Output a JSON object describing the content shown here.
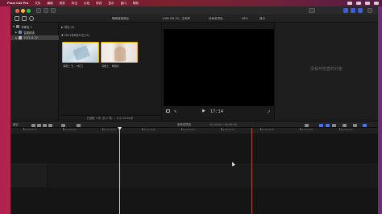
{
  "menubar": {
    "app_name": "Final Cut Pro",
    "items": [
      "文件",
      "编辑",
      "修剪",
      "标记",
      "片段",
      "修改",
      "显示",
      "窗口",
      "帮助"
    ]
  },
  "toolbar": {
    "library_label": "隔离被掐换台",
    "format_label": "1080 HD 25，立体声",
    "project_label": "未命名项目",
    "zoom_label": "48%",
    "view_label": "显示"
  },
  "sidebar": {
    "library_name": "未命名 1",
    "items": [
      {
        "label": "智能精选"
      },
      {
        "label": "2021-8-22"
      }
    ]
  },
  "browser": {
    "event_header": "项目",
    "event_count": "(0)",
    "date_header": "2021年8月22日",
    "date_count": "(2)",
    "clips": [
      {
        "label": "海报上 五 ，5红口"
      },
      {
        "label": "海报上 ，精选片"
      }
    ],
    "footer": "已选取 1 项（共 2 项），4 小 43.44 秒"
  },
  "viewer": {
    "timecode": "17:14"
  },
  "inspector": {
    "empty_text": "没有可检查的对象"
  },
  "timeline_bar": {
    "index_label": "索引",
    "project_name": "未命名项目",
    "duration_label": "00:00:00 / 00:00:00"
  },
  "ruler": {
    "ticks": [
      "00:00:00:00",
      "00:00:05:00",
      "00:00:10:00",
      "00:00:15:00",
      "00:00:20:00",
      "00:00:25:00",
      "00:00:30:00",
      "00:00:35:00",
      "00:00:40:00",
      "00:00:45:00"
    ]
  }
}
